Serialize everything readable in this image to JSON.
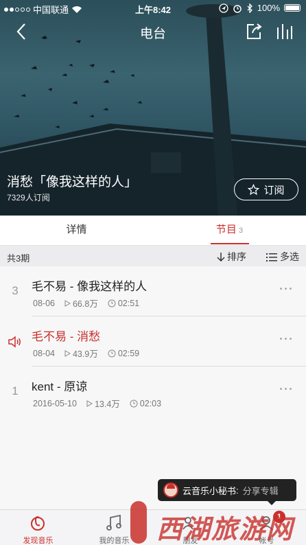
{
  "status_bar": {
    "carrier": "中国联通",
    "time": "上午8:42",
    "battery": "100%"
  },
  "nav": {
    "title": "电台"
  },
  "radio": {
    "title": "消愁「像我这样的人」",
    "subscribers": "7329人订阅",
    "subscribe_label": "订阅"
  },
  "tabs": {
    "details": "详情",
    "programs": "节目",
    "programs_count": "3"
  },
  "list_header": {
    "total": "共3期",
    "sort": "排序",
    "multi_select": "多选"
  },
  "episodes": [
    {
      "index": "3",
      "title": "毛不易 - 像我这样的人",
      "date": "08-06",
      "plays": "66.8万",
      "duration": "02:51",
      "playing": false
    },
    {
      "index": "",
      "title": "毛不易 - 消愁",
      "date": "08-04",
      "plays": "43.9万",
      "duration": "02:59",
      "playing": true
    },
    {
      "index": "1",
      "title": "kent - 原谅",
      "date": "2016-05-10",
      "plays": "13.4万",
      "duration": "02:03",
      "playing": false
    }
  ],
  "tooltip": {
    "name": "云音乐小秘书",
    "separator": ":",
    "action": "分享专辑"
  },
  "tabbar": {
    "discover": "发现音乐",
    "my_music": "我的音乐",
    "friends": "朋友",
    "account": "帐号",
    "account_badge": "1"
  },
  "watermark": "西湖旅游网",
  "colors": {
    "accent": "#c9302c",
    "hero_bg": "#2f5563"
  }
}
